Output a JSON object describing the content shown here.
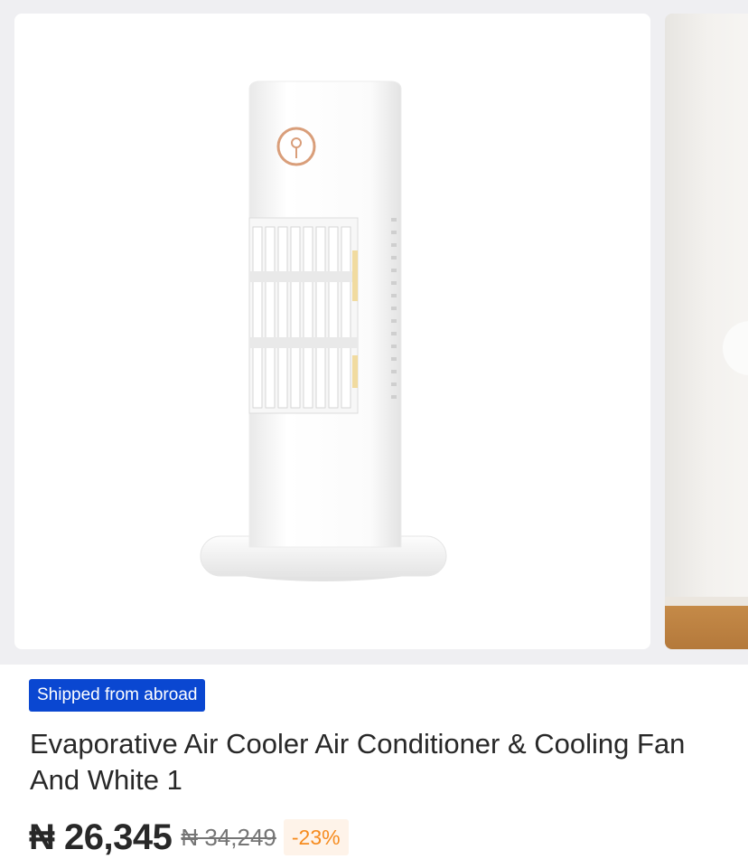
{
  "gallery": {
    "main_image_alt": "Evaporative Air Cooler product image",
    "accent_color": "#d99e7a"
  },
  "product": {
    "badge": "Shipped from abroad",
    "badge_color": "#0a47d1",
    "title": "Evaporative Air Cooler Air Conditioner & Cooling Fan And White 1",
    "price": "₦ 26,345",
    "old_price": "₦ 34,249",
    "discount": "-23%",
    "discount_color": "#f68b1e"
  }
}
